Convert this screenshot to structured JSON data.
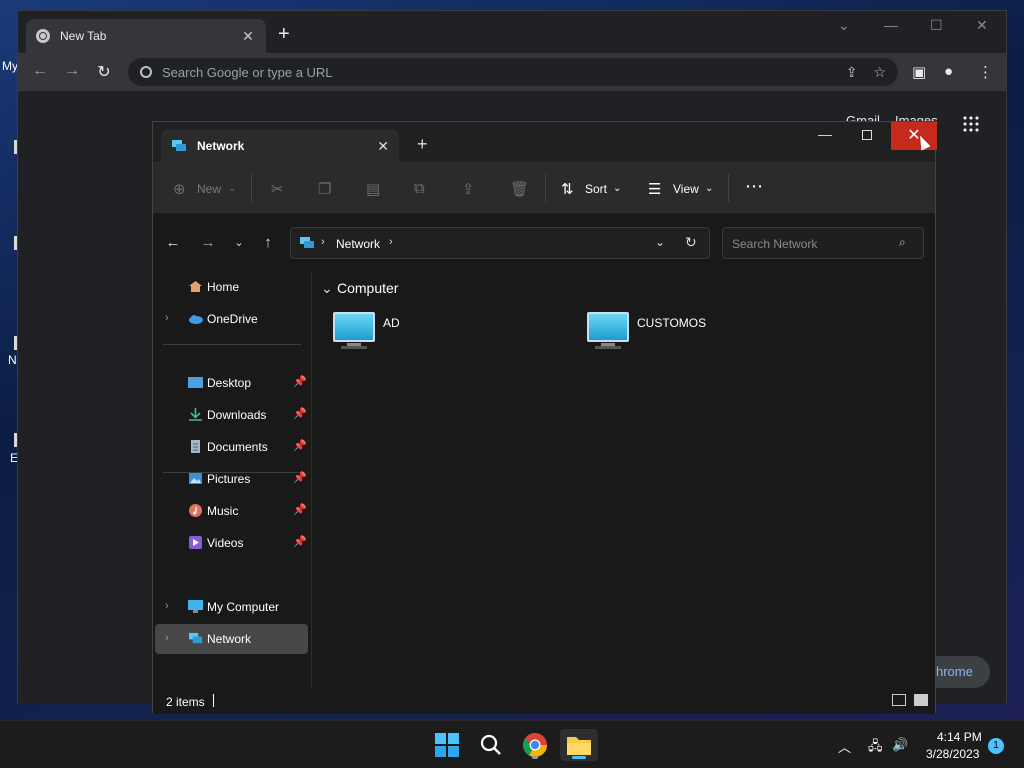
{
  "desktop": {
    "labels": [
      "My",
      "N",
      "E"
    ]
  },
  "chrome": {
    "tab_title": "New Tab",
    "omnibox_placeholder": "Search Google or type a URL",
    "links": [
      "Gmail",
      "Images"
    ],
    "customize_label": "hrome"
  },
  "explorer": {
    "tab_title": "Network",
    "commands": {
      "new": "New",
      "sort": "Sort",
      "view": "View"
    },
    "address": "Network",
    "search_placeholder": "Search Network",
    "nav": {
      "home": "Home",
      "onedrive": "OneDrive",
      "desktop": "Desktop",
      "downloads": "Downloads",
      "documents": "Documents",
      "pictures": "Pictures",
      "music": "Music",
      "videos": "Videos",
      "my_computer": "My Computer",
      "network": "Network"
    },
    "group": "Computer",
    "items": [
      "AD",
      "CUSTOMOS"
    ],
    "status": "2 items"
  },
  "taskbar": {
    "time": "4:14 PM",
    "date": "3/28/2023",
    "notification_count": "1"
  }
}
